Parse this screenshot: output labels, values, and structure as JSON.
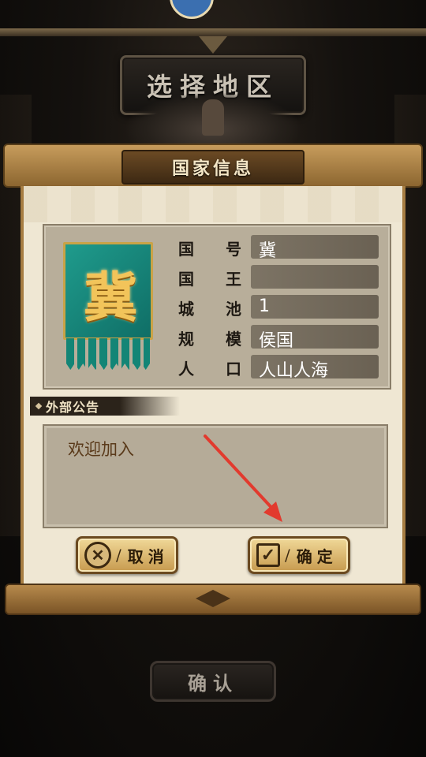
{
  "title": "选择地区",
  "dialog": {
    "title": "国家信息",
    "banner_char": "冀",
    "info_rows": [
      {
        "label": [
          "国",
          "号"
        ],
        "value": "冀"
      },
      {
        "label": [
          "国",
          "王"
        ],
        "value": ""
      },
      {
        "label": [
          "城",
          "池"
        ],
        "value": "1"
      },
      {
        "label": [
          "规",
          "模"
        ],
        "value": "侯国"
      },
      {
        "label": [
          "人",
          "口"
        ],
        "value": "人山人海"
      }
    ],
    "notice_title": "外部公告",
    "notice_text": "欢迎加入",
    "cancel_label": "取消",
    "confirm_label": "确定",
    "separator": "/"
  },
  "confirm_button_label": "确认",
  "colors": {
    "annotation_arrow": "#e23a2e",
    "banner_green": "#1f9b8c",
    "banner_gold": "#f2c45a"
  },
  "icons": {
    "cancel": "close-icon",
    "confirm": "checkmark-icon"
  }
}
